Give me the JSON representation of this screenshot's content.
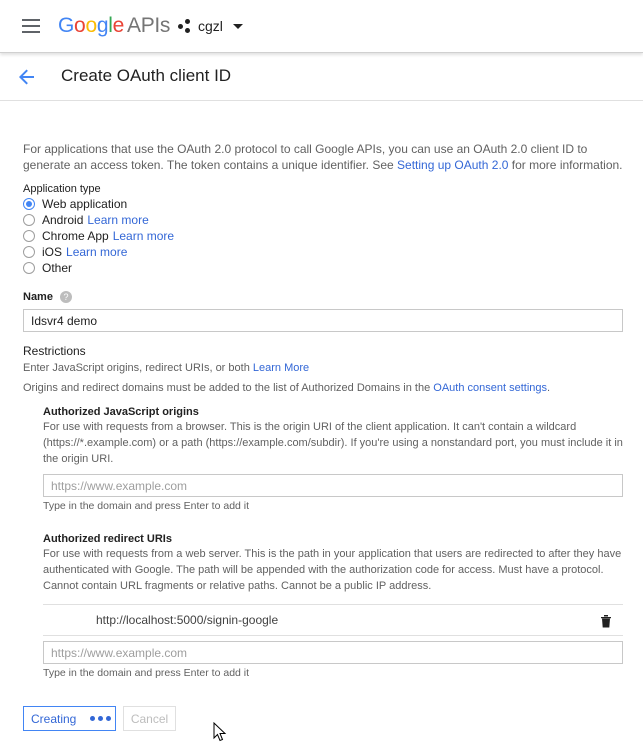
{
  "topbar": {
    "logo_google": "Google",
    "logo_apis": "APIs",
    "project_name": "cgzl"
  },
  "header": {
    "title": "Create OAuth client ID"
  },
  "intro": {
    "text_before_link": "For applications that use the OAuth 2.0 protocol to call Google APIs, you can use an OAuth 2.0 client ID to generate an access token. The token contains a unique identifier. See ",
    "link_text": "Setting up OAuth 2.0",
    "text_after_link": " for more information."
  },
  "application_type": {
    "label": "Application type",
    "options": [
      {
        "label": "Web application",
        "link": "",
        "checked": true
      },
      {
        "label": "Android",
        "link": "Learn more",
        "checked": false
      },
      {
        "label": "Chrome App",
        "link": "Learn more",
        "checked": false
      },
      {
        "label": "iOS",
        "link": "Learn more",
        "checked": false
      },
      {
        "label": "Other",
        "link": "",
        "checked": false
      }
    ]
  },
  "name_field": {
    "label": "Name",
    "help_icon": "?",
    "value": "Idsvr4 demo"
  },
  "restrictions": {
    "title": "Restrictions",
    "line1_text": "Enter JavaScript origins, redirect URIs, or both ",
    "line1_link": "Learn More",
    "line2_text": "Origins and redirect domains must be added to the list of Authorized Domains in the ",
    "line2_link": "OAuth consent settings",
    "line2_end": "."
  },
  "js_origins": {
    "title": "Authorized JavaScript origins",
    "description": "For use with requests from a browser. This is the origin URI of the client application. It can't contain a wildcard (https://*.example.com) or a path (https://example.com/subdir). If you're using a nonstandard port, you must include it in the origin URI.",
    "placeholder": "https://www.example.com",
    "hint": "Type in the domain and press Enter to add it"
  },
  "redirect_uris": {
    "title": "Authorized redirect URIs",
    "description": "For use with requests from a web server. This is the path in your application that users are redirected to after they have authenticated with Google. The path will be appended with the authorization code for access. Must have a protocol. Cannot contain URL fragments or relative paths. Cannot be a public IP address.",
    "entries": [
      "http://localhost:5000/signin-google"
    ],
    "placeholder": "https://www.example.com",
    "hint": "Type in the domain and press Enter to add it"
  },
  "actions": {
    "creating_label": "Creating",
    "cancel_label": "Cancel"
  },
  "icons": {
    "menu": "hamburger-menu-icon",
    "project": "project-dots-icon",
    "dropdown": "caret-down-icon",
    "back": "arrow-left-icon",
    "help": "help-circle-icon",
    "delete": "trash-icon",
    "cursor": "mouse-pointer-icon"
  },
  "colors": {
    "accent": "#4285f4",
    "link": "#3367d6"
  }
}
